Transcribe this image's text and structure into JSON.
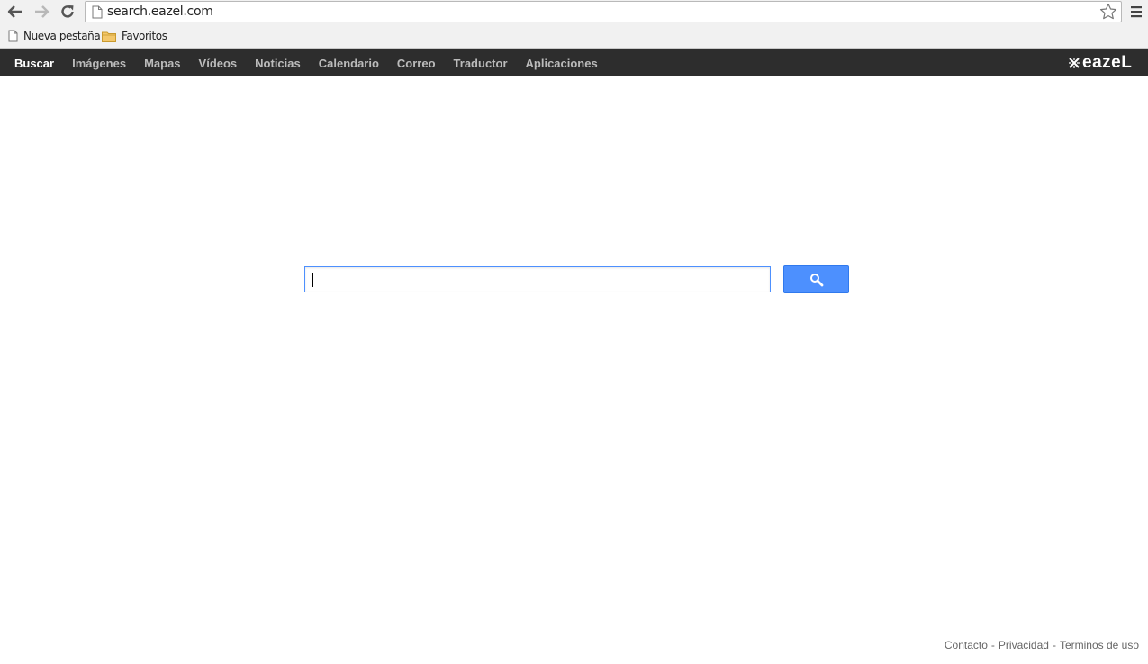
{
  "browser": {
    "url": "search.eazel.com",
    "bookmarks": [
      {
        "label": "Nueva pestaña",
        "icon": "page-icon"
      },
      {
        "label": "Favoritos",
        "icon": "folder-icon"
      }
    ]
  },
  "appbar": {
    "items": [
      "Buscar",
      "Imágenes",
      "Mapas",
      "Vídeos",
      "Noticias",
      "Calendario",
      "Correo",
      "Traductor",
      "Aplicaciones"
    ],
    "active_index": 0,
    "brand": "eazeL"
  },
  "search": {
    "value": "",
    "button_icon": "search-icon"
  },
  "footer": {
    "links": [
      "Contacto",
      "Privacidad",
      "Terminos de uso"
    ],
    "separator": "-"
  },
  "colors": {
    "appbar_bg": "#2d2d2d",
    "accent": "#4d90fe"
  }
}
